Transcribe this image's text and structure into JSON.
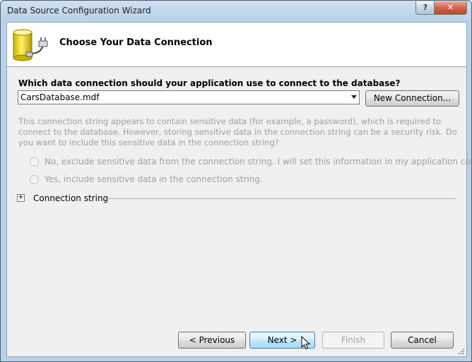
{
  "window": {
    "title": "Data Source Configuration Wizard",
    "help_label": "?",
    "close_label": "✕"
  },
  "header": {
    "title": "Choose Your Data Connection",
    "icon": "database-plug-icon"
  },
  "connection": {
    "question": "Which data connection should your application use to connect to the database?",
    "selected": "CarsDatabase.mdf",
    "new_connection_label": "New Connection..."
  },
  "sensitive": {
    "info": "This connection string appears to contain sensitive data (for example, a password), which is required to connect to the database. However, storing sensitive data in the connection string can be a security risk. Do you want to include this sensitive data in the connection string?",
    "option_exclude": "No, exclude sensitive data from the connection string. I will set this information in my application code.",
    "option_include": "Yes, include sensitive data in the connection string."
  },
  "expander": {
    "symbol": "+",
    "label": "Connection string"
  },
  "footer": {
    "previous_label": "< Previous",
    "next_label": "Next >",
    "finish_label": "Finish",
    "cancel_label": "Cancel"
  },
  "colors": {
    "title_bar": "#b9d1ea",
    "client_bg": "#f0f0f0",
    "disabled_text": "#a0a0a0",
    "default_button": "#bee6fd",
    "close_button": "#c2412b"
  }
}
